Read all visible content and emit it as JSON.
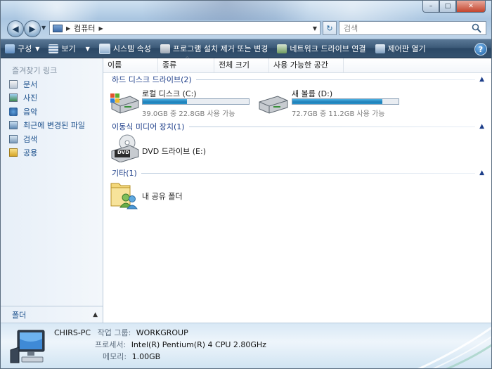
{
  "window": {
    "controls": {
      "minimize": "–",
      "maximize": "□",
      "close": "✕"
    }
  },
  "address": {
    "breadcrumbs": [
      "컴퓨터"
    ],
    "search_placeholder": "검색",
    "refresh_icon": "refresh-icon"
  },
  "toolbar": {
    "items": [
      {
        "label": "구성",
        "icon": "organize-icon",
        "dropdown": true
      },
      {
        "label": "보기",
        "icon": "views-icon",
        "dropdown": true
      },
      {
        "label": "시스템 속성",
        "icon": "system-properties-icon",
        "dropdown": false
      },
      {
        "label": "프로그램 설치 제거 또는 변경",
        "icon": "uninstall-icon",
        "dropdown": false
      },
      {
        "label": "네트워크 드라이브 연결",
        "icon": "map-network-drive-icon",
        "dropdown": false
      },
      {
        "label": "제어판 열기",
        "icon": "control-panel-icon",
        "dropdown": false
      }
    ],
    "help": "?"
  },
  "sidebar": {
    "favorites_header": "즐겨찾기 링크",
    "items": [
      {
        "label": "문서",
        "icon": "documents-icon"
      },
      {
        "label": "사진",
        "icon": "pictures-icon"
      },
      {
        "label": "음악",
        "icon": "music-icon"
      },
      {
        "label": "최근에 변경된 파일",
        "icon": "recent-files-icon"
      },
      {
        "label": "검색",
        "icon": "searches-icon"
      },
      {
        "label": "공용",
        "icon": "public-icon"
      }
    ],
    "folders_label": "폴더"
  },
  "columns": [
    "이름",
    "종류",
    "전체 크기",
    "사용 가능한 공간"
  ],
  "groups": {
    "hdd": {
      "title": "하드 디스크 드라이브(2)",
      "drives": [
        {
          "name": "로컬 디스크 (C:)",
          "info": "39.0GB 중 22.8GB 사용 가능",
          "used_fraction": 0.42
        },
        {
          "name": "새 볼륨 (D:)",
          "info": "72.7GB 중 11.2GB 사용 가능",
          "used_fraction": 0.85
        }
      ]
    },
    "removable": {
      "title": "이동식 미디어 장치(1)",
      "items": [
        {
          "name": "DVD 드라이브 (E:)",
          "icon_text": "DVD"
        }
      ]
    },
    "other": {
      "title": "기타(1)",
      "items": [
        {
          "name": "내 공유 폴더"
        }
      ]
    }
  },
  "status": {
    "computer_name": "CHIRS-PC",
    "workgroup_label": "작업 그룹:",
    "workgroup": "WORKGROUP",
    "processor_label": "프로세서:",
    "processor": "Intel(R) Pentium(R) 4 CPU 2.80GHz",
    "memory_label": "메모리:",
    "memory": "1.00GB"
  },
  "colors": {
    "accent": "#1e3f8a",
    "link": "#1a4f8b",
    "drive_fill": "#1f7fb8",
    "toolbar": "#3c5a78"
  }
}
